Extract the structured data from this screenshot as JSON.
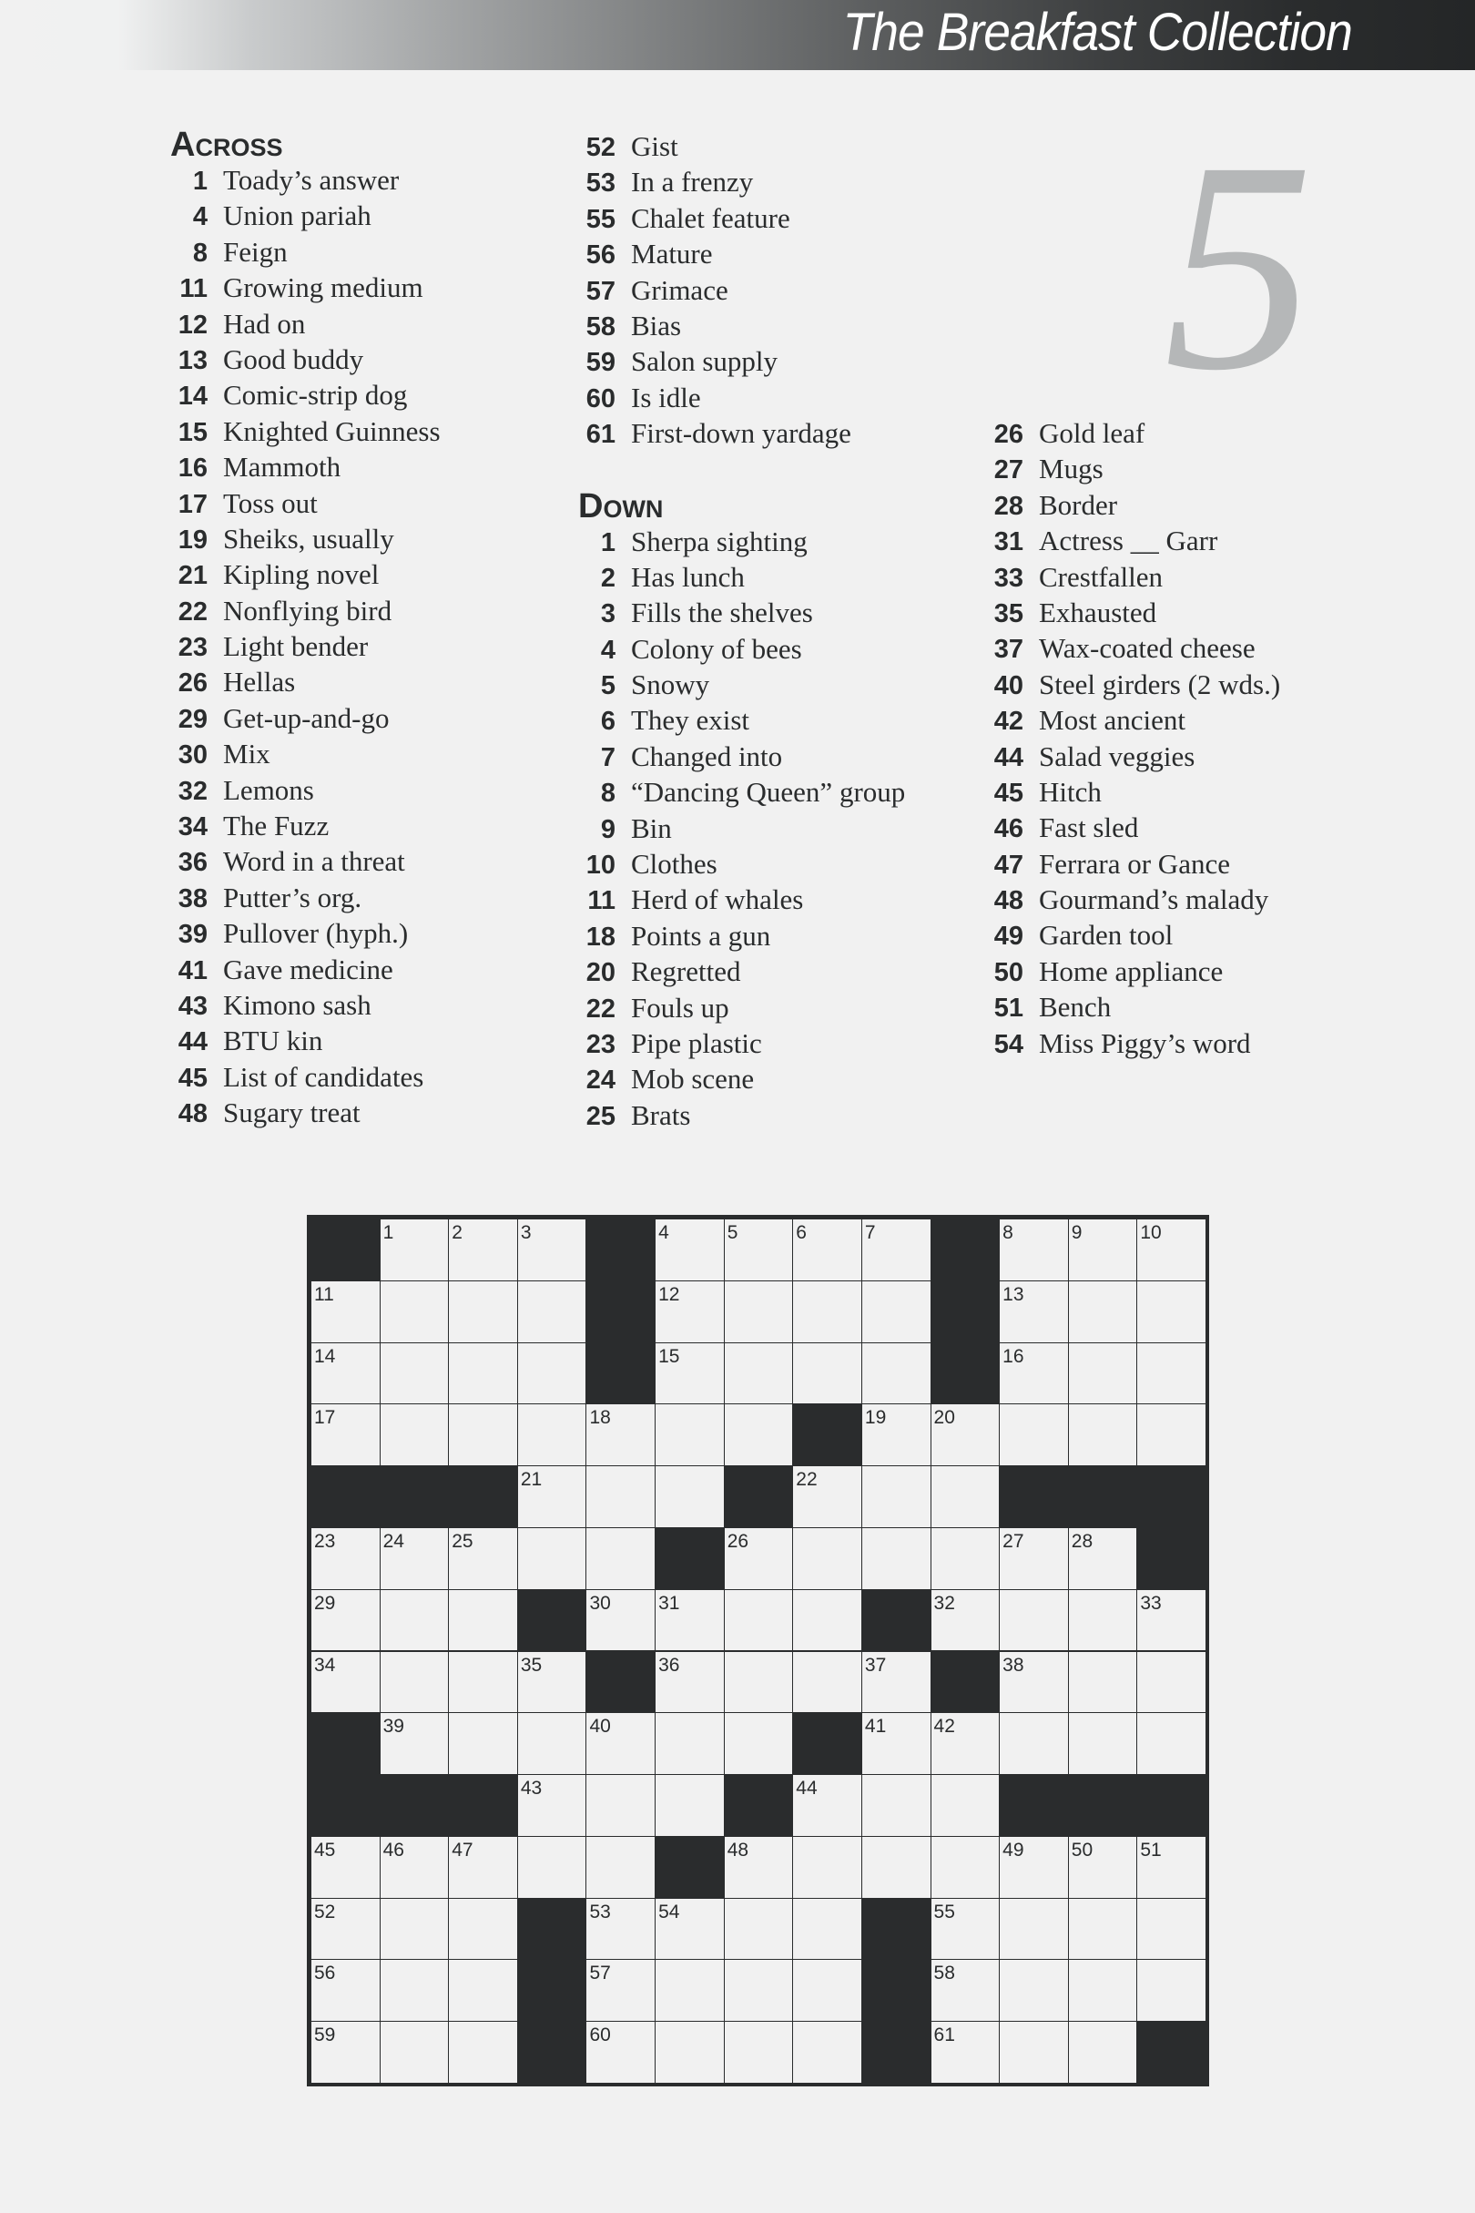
{
  "header": {
    "title": "The Breakfast Collection"
  },
  "puzzle_number": "5",
  "across": {
    "heading": "Across",
    "clues": [
      {
        "num": "1",
        "text": "Toady’s answer"
      },
      {
        "num": "4",
        "text": "Union pariah"
      },
      {
        "num": "8",
        "text": "Feign"
      },
      {
        "num": "11",
        "text": "Growing medium"
      },
      {
        "num": "12",
        "text": "Had on"
      },
      {
        "num": "13",
        "text": "Good buddy"
      },
      {
        "num": "14",
        "text": "Comic-strip dog"
      },
      {
        "num": "15",
        "text": "Knighted Guinness"
      },
      {
        "num": "16",
        "text": "Mammoth"
      },
      {
        "num": "17",
        "text": "Toss out"
      },
      {
        "num": "19",
        "text": "Sheiks, usually"
      },
      {
        "num": "21",
        "text": "Kipling novel"
      },
      {
        "num": "22",
        "text": "Nonflying bird"
      },
      {
        "num": "23",
        "text": "Light bender"
      },
      {
        "num": "26",
        "text": "Hellas"
      },
      {
        "num": "29",
        "text": "Get-up-and-go"
      },
      {
        "num": "30",
        "text": "Mix"
      },
      {
        "num": "32",
        "text": "Lemons"
      },
      {
        "num": "34",
        "text": "The Fuzz"
      },
      {
        "num": "36",
        "text": "Word in a threat"
      },
      {
        "num": "38",
        "text": "Putter’s org."
      },
      {
        "num": "39",
        "text": "Pullover (hyph.)"
      },
      {
        "num": "41",
        "text": "Gave medicine"
      },
      {
        "num": "43",
        "text": "Kimono sash"
      },
      {
        "num": "44",
        "text": "BTU kin"
      },
      {
        "num": "45",
        "text": "List of candidates"
      },
      {
        "num": "48",
        "text": "Sugary treat"
      },
      {
        "num": "52",
        "text": "Gist"
      },
      {
        "num": "53",
        "text": "In a frenzy"
      },
      {
        "num": "55",
        "text": "Chalet feature"
      },
      {
        "num": "56",
        "text": "Mature"
      },
      {
        "num": "57",
        "text": "Grimace"
      },
      {
        "num": "58",
        "text": "Bias"
      },
      {
        "num": "59",
        "text": "Salon supply"
      },
      {
        "num": "60",
        "text": "Is idle"
      },
      {
        "num": "61",
        "text": "First-down yardage"
      }
    ]
  },
  "down": {
    "heading": "Down",
    "clues": [
      {
        "num": "1",
        "text": "Sherpa sighting"
      },
      {
        "num": "2",
        "text": "Has lunch"
      },
      {
        "num": "3",
        "text": "Fills the shelves"
      },
      {
        "num": "4",
        "text": "Colony of bees"
      },
      {
        "num": "5",
        "text": "Snowy"
      },
      {
        "num": "6",
        "text": "They exist"
      },
      {
        "num": "7",
        "text": "Changed into"
      },
      {
        "num": "8",
        "text": "“Dancing Queen” group"
      },
      {
        "num": "9",
        "text": "Bin"
      },
      {
        "num": "10",
        "text": "Clothes"
      },
      {
        "num": "11",
        "text": "Herd of whales"
      },
      {
        "num": "18",
        "text": "Points a gun"
      },
      {
        "num": "20",
        "text": "Regretted"
      },
      {
        "num": "22",
        "text": "Fouls up"
      },
      {
        "num": "23",
        "text": "Pipe plastic"
      },
      {
        "num": "24",
        "text": "Mob scene"
      },
      {
        "num": "25",
        "text": "Brats"
      },
      {
        "num": "26",
        "text": "Gold leaf"
      },
      {
        "num": "27",
        "text": "Mugs"
      },
      {
        "num": "28",
        "text": "Border"
      },
      {
        "num": "31",
        "text": "Actress __ Garr"
      },
      {
        "num": "33",
        "text": "Crestfallen"
      },
      {
        "num": "35",
        "text": "Exhausted"
      },
      {
        "num": "37",
        "text": "Wax-coated cheese"
      },
      {
        "num": "40",
        "text": "Steel girders (2 wds.)"
      },
      {
        "num": "42",
        "text": "Most ancient"
      },
      {
        "num": "44",
        "text": "Salad veggies"
      },
      {
        "num": "45",
        "text": "Hitch"
      },
      {
        "num": "46",
        "text": "Fast sled"
      },
      {
        "num": "47",
        "text": "Ferrara or Gance"
      },
      {
        "num": "48",
        "text": "Gourmand’s malady"
      },
      {
        "num": "49",
        "text": "Garden tool"
      },
      {
        "num": "50",
        "text": "Home appliance"
      },
      {
        "num": "51",
        "text": "Bench"
      },
      {
        "num": "54",
        "text": "Miss Piggy’s word"
      }
    ]
  },
  "grid": {
    "cols": 13,
    "rows": 14,
    "layout": [
      "#...#....#...",
      "....#....#...",
      "....#....#...",
      ".......#.....",
      "###...#...###",
      ".....#......#",
      "...#....#....",
      "....#....#...",
      "#......#.....",
      "###...#...###",
      ".....#.......",
      "...#....#....",
      "...#....#....",
      "...#....#...#"
    ],
    "numbers": [
      [
        0,
        1,
        "1"
      ],
      [
        0,
        2,
        "2"
      ],
      [
        0,
        3,
        "3"
      ],
      [
        0,
        5,
        "4"
      ],
      [
        0,
        6,
        "5"
      ],
      [
        0,
        7,
        "6"
      ],
      [
        0,
        8,
        "7"
      ],
      [
        0,
        10,
        "8"
      ],
      [
        0,
        11,
        "9"
      ],
      [
        0,
        12,
        "10"
      ],
      [
        1,
        0,
        "11"
      ],
      [
        1,
        5,
        "12"
      ],
      [
        1,
        10,
        "13"
      ],
      [
        2,
        0,
        "14"
      ],
      [
        2,
        5,
        "15"
      ],
      [
        2,
        10,
        "16"
      ],
      [
        3,
        0,
        "17"
      ],
      [
        3,
        4,
        "18"
      ],
      [
        3,
        8,
        "19"
      ],
      [
        3,
        9,
        "20"
      ],
      [
        4,
        3,
        "21"
      ],
      [
        4,
        7,
        "22"
      ],
      [
        5,
        0,
        "23"
      ],
      [
        5,
        1,
        "24"
      ],
      [
        5,
        2,
        "25"
      ],
      [
        5,
        6,
        "26"
      ],
      [
        5,
        10,
        "27"
      ],
      [
        5,
        11,
        "28"
      ],
      [
        6,
        0,
        "29"
      ],
      [
        6,
        4,
        "30"
      ],
      [
        6,
        5,
        "31"
      ],
      [
        6,
        9,
        "32"
      ],
      [
        6,
        12,
        "33"
      ],
      [
        7,
        0,
        "34"
      ],
      [
        7,
        3,
        "35"
      ],
      [
        7,
        5,
        "36"
      ],
      [
        7,
        8,
        "37"
      ],
      [
        7,
        10,
        "38"
      ],
      [
        8,
        1,
        "39"
      ],
      [
        8,
        4,
        "40"
      ],
      [
        8,
        8,
        "41"
      ],
      [
        8,
        9,
        "42"
      ],
      [
        9,
        3,
        "43"
      ],
      [
        9,
        7,
        "44"
      ],
      [
        10,
        0,
        "45"
      ],
      [
        10,
        1,
        "46"
      ],
      [
        10,
        2,
        "47"
      ],
      [
        10,
        6,
        "48"
      ],
      [
        10,
        10,
        "49"
      ],
      [
        10,
        11,
        "50"
      ],
      [
        10,
        12,
        "51"
      ],
      [
        11,
        0,
        "52"
      ],
      [
        11,
        4,
        "53"
      ],
      [
        11,
        5,
        "54"
      ],
      [
        11,
        9,
        "55"
      ],
      [
        12,
        0,
        "56"
      ],
      [
        12,
        4,
        "57"
      ],
      [
        12,
        9,
        "58"
      ],
      [
        13,
        0,
        "59"
      ],
      [
        13,
        4,
        "60"
      ],
      [
        13,
        9,
        "61"
      ]
    ]
  }
}
